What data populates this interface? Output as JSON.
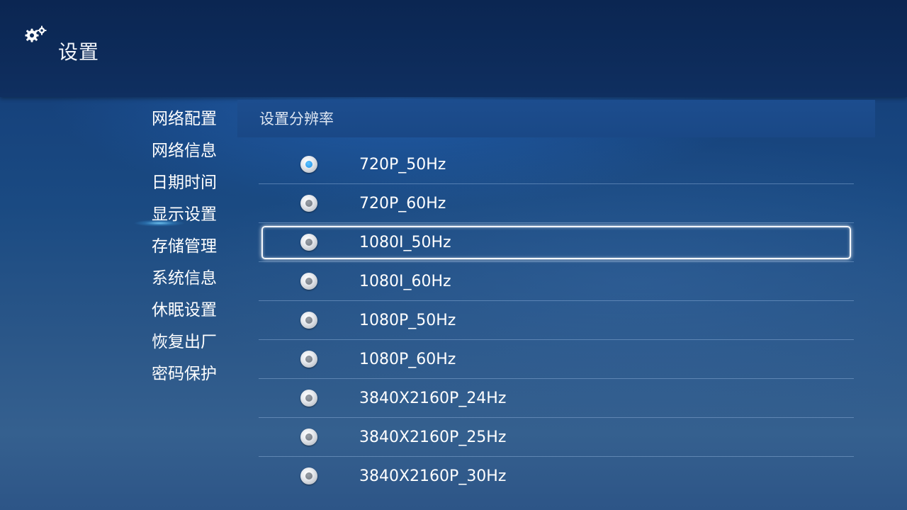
{
  "header": {
    "title": "设置",
    "icon": "gears-icon"
  },
  "sidebar": {
    "active_index": 3,
    "items": [
      {
        "label": "网络配置"
      },
      {
        "label": "网络信息"
      },
      {
        "label": "日期时间"
      },
      {
        "label": "显示设置"
      },
      {
        "label": "存储管理"
      },
      {
        "label": "系统信息"
      },
      {
        "label": "休眠设置"
      },
      {
        "label": "恢复出厂"
      },
      {
        "label": "密码保护"
      }
    ]
  },
  "main": {
    "section_title": "设置分辨率",
    "selected_index": 0,
    "focused_index": 2,
    "options": [
      {
        "label": "720P_50Hz"
      },
      {
        "label": "720P_60Hz"
      },
      {
        "label": "1080I_50Hz"
      },
      {
        "label": "1080I_60Hz"
      },
      {
        "label": "1080P_50Hz"
      },
      {
        "label": "1080P_60Hz"
      },
      {
        "label": "3840X2160P_24Hz"
      },
      {
        "label": "3840X2160P_25Hz"
      },
      {
        "label": "3840X2160P_30Hz"
      }
    ]
  },
  "colors": {
    "selected_radio": "#1d8fe8",
    "focus_border": "#f4f7fb"
  }
}
